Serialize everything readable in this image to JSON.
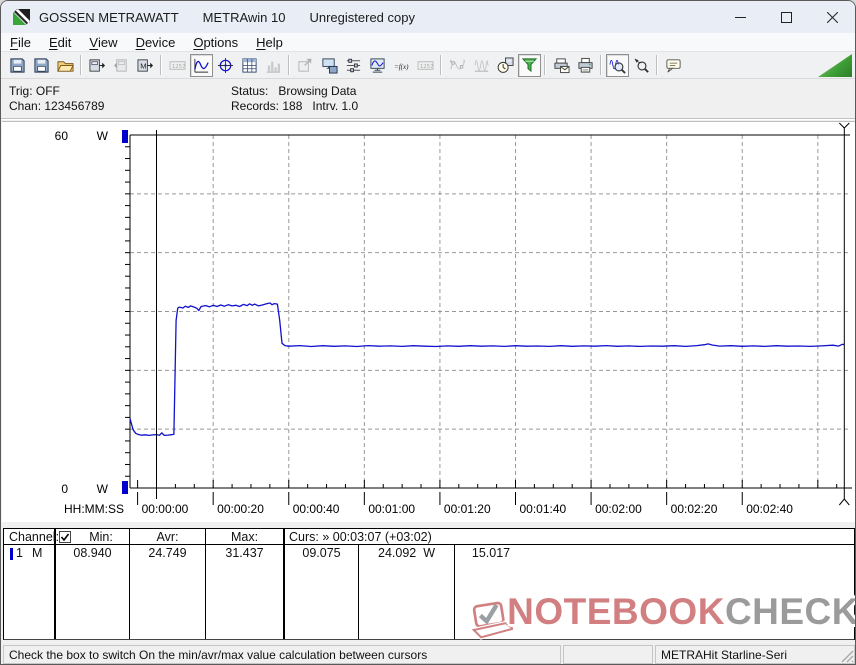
{
  "window": {
    "title_app": "GOSSEN METRAWATT",
    "title_program": "METRAwin 10",
    "title_license": "Unregistered copy",
    "controls": {
      "minimize": "minimize",
      "maximize": "maximize",
      "close": "close"
    }
  },
  "menu": {
    "items": [
      {
        "label": "File",
        "hotkey": "F"
      },
      {
        "label": "Edit",
        "hotkey": "E"
      },
      {
        "label": "View",
        "hotkey": "V"
      },
      {
        "label": "Device",
        "hotkey": "D"
      },
      {
        "label": "Options",
        "hotkey": "O"
      },
      {
        "label": "Help",
        "hotkey": "H"
      }
    ]
  },
  "toolbar": {
    "buttons": [
      {
        "icon": "save-file",
        "state": "normal"
      },
      {
        "icon": "save-channels",
        "state": "normal"
      },
      {
        "icon": "open-file",
        "state": "normal"
      },
      {
        "sep": true
      },
      {
        "icon": "read-device",
        "state": "normal"
      },
      {
        "icon": "send-device",
        "state": "disabled"
      },
      {
        "icon": "device-memory",
        "state": "normal"
      },
      {
        "sep": true
      },
      {
        "icon": "numeric-display",
        "state": "disabled"
      },
      {
        "icon": "chart-view",
        "state": "pressed"
      },
      {
        "icon": "cursor-view",
        "state": "normal"
      },
      {
        "icon": "table-view",
        "state": "normal"
      },
      {
        "icon": "statistics-view",
        "state": "disabled"
      },
      {
        "sep": true
      },
      {
        "icon": "export-window",
        "state": "disabled"
      },
      {
        "icon": "save-config",
        "state": "normal"
      },
      {
        "icon": "channel-settings",
        "state": "normal"
      },
      {
        "icon": "monitor-settings",
        "state": "normal"
      },
      {
        "icon": "formula",
        "state": "normal"
      },
      {
        "icon": "device-config",
        "state": "disabled"
      },
      {
        "sep": true
      },
      {
        "icon": "analog-wave",
        "state": "disabled"
      },
      {
        "icon": "digital-wave",
        "state": "disabled"
      },
      {
        "icon": "time-settings",
        "state": "normal"
      },
      {
        "icon": "trigger",
        "state": "pressed"
      },
      {
        "sep": true
      },
      {
        "icon": "print-preview",
        "state": "normal"
      },
      {
        "icon": "print",
        "state": "normal"
      },
      {
        "sep": true
      },
      {
        "icon": "zoom-time",
        "state": "pressed"
      },
      {
        "icon": "zoom-value",
        "state": "normal"
      },
      {
        "sep": true
      },
      {
        "icon": "annotation",
        "state": "normal"
      }
    ]
  },
  "status_panel": {
    "trig": "Trig: OFF",
    "chan": "Chan: 123456789",
    "status": "Status:   Browsing Data",
    "records": "Records: 188   Intrv. 1.0"
  },
  "chart_data": {
    "type": "line",
    "title": "Power vs time (METRAwin 10 recording)",
    "x_axis_label": "HH:MM:SS",
    "x_range_s": [
      -2,
      188
    ],
    "x_grid_step_s": 20,
    "x_minor_tick_s": 5,
    "x_ticks": [
      {
        "t": 0,
        "label": "00:00:00"
      },
      {
        "t": 20,
        "label": "00:00:20"
      },
      {
        "t": 40,
        "label": "00:00:40"
      },
      {
        "t": 60,
        "label": "00:01:00"
      },
      {
        "t": 80,
        "label": "00:01:20"
      },
      {
        "t": 100,
        "label": "00:01:40"
      },
      {
        "t": 120,
        "label": "00:02:00"
      },
      {
        "t": 140,
        "label": "00:02:20"
      },
      {
        "t": 160,
        "label": "00:02:40"
      }
    ],
    "y_range": [
      0,
      60
    ],
    "y_unit": "W",
    "y_max_label": "60",
    "y_min_label": "0",
    "y_grid_step": 10,
    "y_minor_tick": 2,
    "grid_on": true,
    "cursors": [
      {
        "t": 5,
        "name": "cursor-1",
        "handles": false
      },
      {
        "t": 187,
        "name": "cursor-2",
        "handles": true
      }
    ],
    "series": [
      {
        "name": "channel-1-power-W",
        "color": "#1111cc",
        "points": [
          [
            -2,
            11.8
          ],
          [
            -1.2,
            9.9
          ],
          [
            -0.5,
            9.3
          ],
          [
            0,
            9.15
          ],
          [
            1,
            8.98
          ],
          [
            2,
            9.05
          ],
          [
            3,
            8.94
          ],
          [
            4,
            9.02
          ],
          [
            5,
            9.08
          ],
          [
            5.8,
            8.96
          ],
          [
            6.4,
            9.38
          ],
          [
            7,
            8.95
          ],
          [
            8,
            9.0
          ],
          [
            9,
            9.06
          ],
          [
            9.6,
            9.15
          ],
          [
            10.2,
            28.5
          ],
          [
            10.6,
            30.55
          ],
          [
            11,
            30.75
          ],
          [
            12,
            30.6
          ],
          [
            12.6,
            30.9
          ],
          [
            13.4,
            30.7
          ],
          [
            14,
            30.95
          ],
          [
            15,
            30.75
          ],
          [
            15.7,
            30.55
          ],
          [
            16.2,
            30.15
          ],
          [
            16.8,
            30.85
          ],
          [
            18,
            31.0
          ],
          [
            19,
            30.8
          ],
          [
            20,
            31.05
          ],
          [
            21,
            30.85
          ],
          [
            22,
            31.1
          ],
          [
            23,
            30.9
          ],
          [
            24,
            31.15
          ],
          [
            25,
            30.95
          ],
          [
            26,
            31.05
          ],
          [
            27,
            30.85
          ],
          [
            28,
            31.2
          ],
          [
            29,
            31.0
          ],
          [
            29.6,
            31.3
          ],
          [
            30.4,
            31.05
          ],
          [
            31,
            31.25
          ],
          [
            32,
            30.95
          ],
          [
            33,
            31.1
          ],
          [
            34,
            31.3
          ],
          [
            35,
            31.44
          ],
          [
            35.6,
            31.15
          ],
          [
            36.2,
            31.35
          ],
          [
            37,
            31.25
          ],
          [
            37.6,
            28.5
          ],
          [
            38.2,
            24.6
          ],
          [
            39,
            24.2
          ],
          [
            40,
            24.1
          ],
          [
            43,
            24.2
          ],
          [
            46,
            24.05
          ],
          [
            49,
            24.18
          ],
          [
            52,
            24.08
          ],
          [
            55,
            24.16
          ],
          [
            58,
            24.05
          ],
          [
            61,
            24.2
          ],
          [
            64,
            24.1
          ],
          [
            67,
            24.16
          ],
          [
            70,
            24.06
          ],
          [
            73,
            24.18
          ],
          [
            76,
            24.1
          ],
          [
            79,
            24.05
          ],
          [
            82,
            24.16
          ],
          [
            85,
            24.08
          ],
          [
            88,
            24.18
          ],
          [
            91,
            24.1
          ],
          [
            94,
            24.16
          ],
          [
            97,
            24.06
          ],
          [
            100,
            24.18
          ],
          [
            103,
            24.1
          ],
          [
            106,
            24.14
          ],
          [
            109,
            24.06
          ],
          [
            112,
            24.18
          ],
          [
            115,
            24.08
          ],
          [
            118,
            24.16
          ],
          [
            121,
            24.1
          ],
          [
            124,
            24.2
          ],
          [
            127,
            24.08
          ],
          [
            130,
            24.16
          ],
          [
            133,
            24.06
          ],
          [
            136,
            24.14
          ],
          [
            139,
            24.1
          ],
          [
            142,
            24.18
          ],
          [
            145,
            24.06
          ],
          [
            148,
            24.2
          ],
          [
            150,
            24.35
          ],
          [
            151,
            24.5
          ],
          [
            152,
            24.3
          ],
          [
            154,
            24.12
          ],
          [
            157,
            24.18
          ],
          [
            160,
            24.08
          ],
          [
            163,
            24.16
          ],
          [
            166,
            24.06
          ],
          [
            169,
            24.18
          ],
          [
            172,
            24.1
          ],
          [
            175,
            24.14
          ],
          [
            178,
            24.06
          ],
          [
            181,
            24.16
          ],
          [
            184,
            24.28
          ],
          [
            185.5,
            24.12
          ],
          [
            186.5,
            24.42
          ],
          [
            187,
            24.35
          ]
        ]
      }
    ]
  },
  "table": {
    "header": {
      "channel": "Channel:",
      "min": "Min:",
      "avr": "Avr:",
      "max": "Max:",
      "curs": "Curs: » 00:03:07 (+03:02)",
      "checkbox_checked": true
    },
    "row": {
      "channel": "1",
      "mode": "M",
      "min": "08.940",
      "avr": "24.749",
      "max": "31.437",
      "curs1": "09.075",
      "curs2": "24.092",
      "curs2_unit": "W",
      "delta": "15.017"
    }
  },
  "watermark": {
    "text_primary": "NOTEBOOK",
    "text_secondary": "CHECK"
  },
  "statusbar": {
    "message": "Check the box to switch On the min/avr/max value calculation between cursors",
    "middle": "",
    "device": "METRAHit Starline-Seri"
  },
  "colors": {
    "line_blue": "#1111cc",
    "channel_marker": "#0000cc",
    "watermark_red": "#d27f81",
    "watermark_gray": "#9b9b9b",
    "trigger_green": "#39a13c",
    "titlebar_bg": "#e9eef6"
  }
}
